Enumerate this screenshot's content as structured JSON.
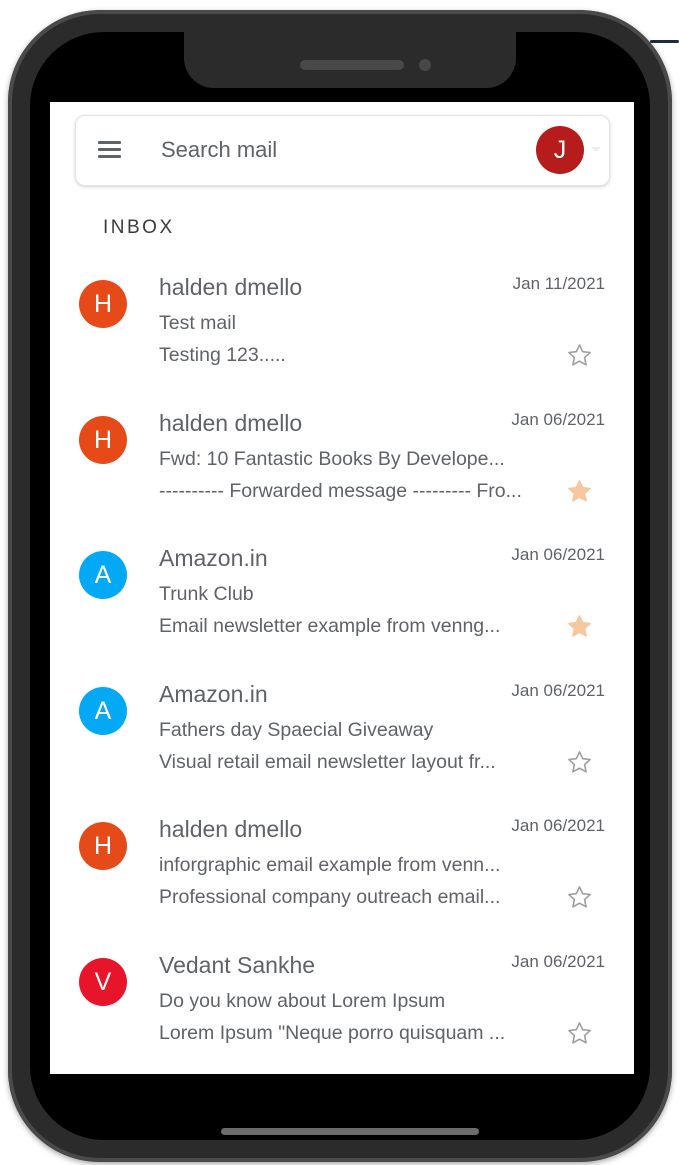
{
  "search": {
    "placeholder": "Search mail"
  },
  "user": {
    "initial": "J",
    "avatar_color": "#b71c1c"
  },
  "inbox": {
    "heading": "INBOX"
  },
  "colors": {
    "star_filled": "#f6c8a0",
    "star_empty": "#9e9e9e",
    "text": "#5f6368"
  },
  "emails": [
    {
      "initial": "H",
      "avatar_color": "#e64a19",
      "sender": "halden dmello",
      "date": "Jan 11/2021",
      "subject": "Test mail",
      "preview": "Testing 123.....",
      "starred": false
    },
    {
      "initial": "H",
      "avatar_color": "#e64a19",
      "sender": "halden dmello",
      "date": "Jan 06/2021",
      "subject": "Fwd: 10 Fantastic Books By Develope...",
      "preview": "---------- Forwarded message --------- Fro...",
      "starred": true
    },
    {
      "initial": "A",
      "avatar_color": "#03a9f4",
      "sender": "Amazon.in",
      "date": "Jan 06/2021",
      "subject": "Trunk Club",
      "preview": "Email newsletter example from venng...",
      "starred": true
    },
    {
      "initial": "A",
      "avatar_color": "#03a9f4",
      "sender": "Amazon.in",
      "date": "Jan 06/2021",
      "subject": "Fathers day Spaecial Giveaway",
      "preview": "Visual retail email newsletter layout fr...",
      "starred": false
    },
    {
      "initial": "H",
      "avatar_color": "#e64a19",
      "sender": "halden dmello",
      "date": "Jan 06/2021",
      "subject": "inforgraphic email example from venn...",
      "preview": "Professional company outreach email...",
      "starred": false
    },
    {
      "initial": "V",
      "avatar_color": "#e8142a",
      "sender": "Vedant Sankhe",
      "date": "Jan 06/2021",
      "subject": "Do you know about Lorem Ipsum",
      "preview": "Lorem Ipsum \"Neque porro quisquam ...",
      "starred": false
    }
  ]
}
